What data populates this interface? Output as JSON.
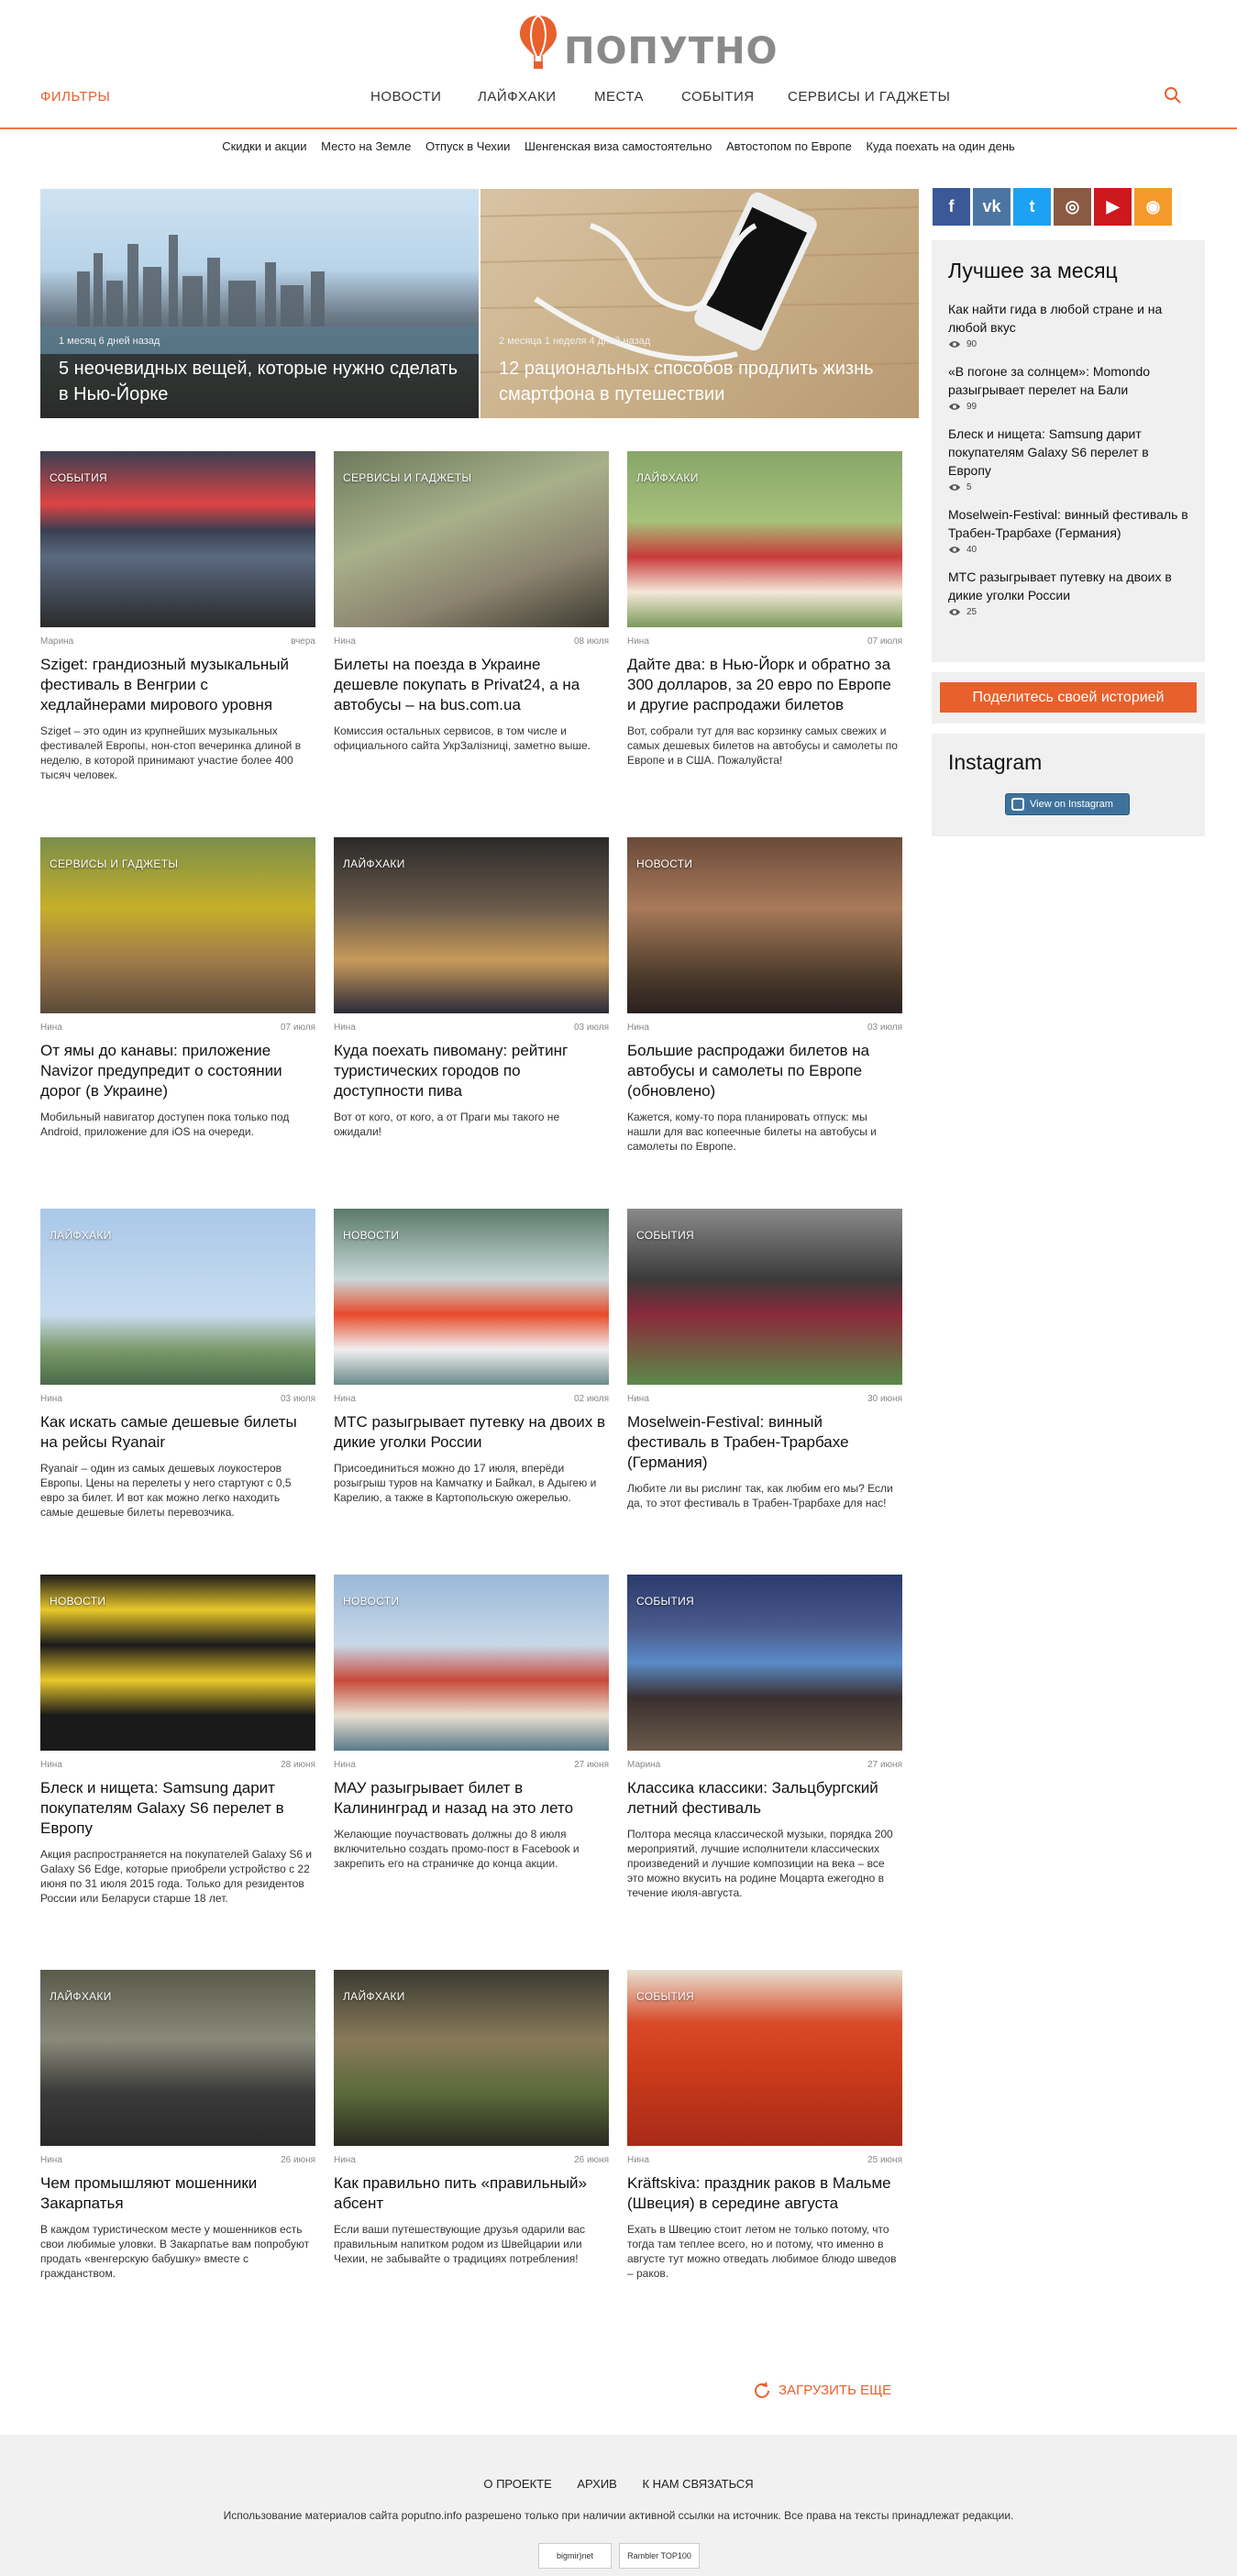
{
  "header": {
    "logo_text": "ПОПУТНО",
    "filters": "ФИЛЬТРЫ",
    "nav": [
      "НОВОСТИ",
      "ЛАЙФХАКИ",
      "МЕСТА",
      "СОБЫТИЯ",
      "СЕРВИСЫ И ГАДЖЕТЫ"
    ]
  },
  "tags": [
    "Скидки и акции",
    "Место на Земле",
    "Отпуск в Чехии",
    "Шенгенская виза самостоятельно",
    "Автостопом по Европе",
    "Куда поехать на один день"
  ],
  "hero": [
    {
      "meta": "1 месяц 6 дней назад",
      "title": "5 неочевидных вещей, которые нужно сделать в Нью-Йорке"
    },
    {
      "meta": "2 месяца 1 неделя 4 дней назад",
      "title": "12 рациональных способов продлить жизнь смартфона в путешествии"
    }
  ],
  "cards": [
    {
      "cat": "СОБЫТИЯ",
      "author": "Марина",
      "date": "вчера",
      "title": "Sziget: грандиозный музыкальный фестиваль в Венгрии с хедлайнерами мирового уровня",
      "text": "Sziget – это один из крупнейших музыкальных фестивалей Европы, нон-стоп вечеринка длиной в неделю, в которой принимают участие более 400 тысяч человек."
    },
    {
      "cat": "СЕРВИСЫ И ГАДЖЕТЫ",
      "author": "Нина",
      "date": "08 июля",
      "title": "Билеты на поезда в Украине дешевле покупать в Privat24, а на автобусы – на bus.com.ua",
      "text": "Комиссия остальных сервисов, в том числе и официального сайта УкрЗалізниці, заметно выше."
    },
    {
      "cat": "ЛАЙФХАКИ",
      "author": "Нина",
      "date": "07 июля",
      "title": "Дайте два: в Нью-Йорк и обратно за 300 долларов, за 20 евро по Европе и другие распродажи билетов",
      "text": "Вот, собрали тут для вас корзинку самых свежих и самых дешевых билетов на автобусы и самолеты по Европе и в США. Пожалуйста!"
    },
    {
      "cat": "СЕРВИСЫ И ГАДЖЕТЫ",
      "author": "Нина",
      "date": "07 июля",
      "title": "От ямы до канавы: приложение Navizor предупредит о состоянии дорог (в Украине)",
      "text": "Мобильный навигатор доступен пока только под Android, приложение для iOS на очереди."
    },
    {
      "cat": "ЛАЙФХАКИ",
      "author": "Нина",
      "date": "03 июля",
      "title": "Куда поехать пивоману: рейтинг туристических городов по доступности пива",
      "text": "Вот от кого, от кого, а от Праги мы такого не ожидали!"
    },
    {
      "cat": "НОВОСТИ",
      "author": "Нина",
      "date": "03 июля",
      "title": "Большие распродажи билетов на автобусы и самолеты по Европе (обновлено)",
      "text": "Кажется, кому-то пора планировать отпуск: мы нашли для вас копеечные билеты на автобусы и самолеты по Европе."
    },
    {
      "cat": "ЛАЙФХАКИ",
      "author": "Нина",
      "date": "03 июля",
      "title": "Как искать самые дешевые билеты на рейсы Ryanair",
      "text": "Ryanair – один из самых дешевых лоукостеров Европы. Цены на перелеты у него стартуют с 0,5 евро за билет. И вот как можно легко находить самые дешевые билеты перевозчика."
    },
    {
      "cat": "НОВОСТИ",
      "author": "Нина",
      "date": "02 июля",
      "title": "МТС разыгрывает путевку на двоих в дикие уголки России",
      "text": "Присоединиться можно до 17 июля, вперёди розыгрыш туров на Камчатку и Байкал, в Адыгею и Карелию, а также в Картопольскую ожерелью."
    },
    {
      "cat": "СОБЫТИЯ",
      "author": "Нина",
      "date": "30 июня",
      "title": "Moselwein-Festival: винный фестиваль в Трабен-Трарбахе (Германия)",
      "text": "Любите ли вы рислинг так, как любим его мы? Если да, то этот фестиваль в Трабен-Трарбахе для нас!"
    },
    {
      "cat": "НОВОСТИ",
      "author": "Нина",
      "date": "28 июня",
      "title": "Блеск и нищета: Samsung дарит покупателям Galaxy S6 перелет в Европу",
      "text": "Акция распространяется на покупателей Galaxy S6 и Galaxy S6 Edge, которые приобрели устройство с 22 июня по 31 июля 2015 года. Только для резидентов России или Беларуси старше 18 лет."
    },
    {
      "cat": "НОВОСТИ",
      "author": "Нина",
      "date": "27 июня",
      "title": "МАУ разыгрывает билет в Калининград и назад на это лето",
      "text": "Желающие поучаствовать должны до 8 июля включительно создать промо-пост в Facebook и закрепить его на страничке до конца акции."
    },
    {
      "cat": "СОБЫТИЯ",
      "author": "Марина",
      "date": "27 июня",
      "title": "Классика классики: Зальцбургский летний фестиваль",
      "text": "Полтора месяца классической музыки, порядка 200 мероприятий, лучшие исполнители классических произведений и лучшие композиции на века – все это можно вкусить на родине Моцарта ежегодно в течение июля-августа."
    },
    {
      "cat": "ЛАЙФХАКИ",
      "author": "Нина",
      "date": "26 июня",
      "title": "Чем промышляют мошенники Закарпатья",
      "text": "В каждом туристическом месте у мошенников есть свои любимые уловки. В Закарпатье вам попробуют продать «венгерскую бабушку» вместе с гражданством."
    },
    {
      "cat": "ЛАЙФХАКИ",
      "author": "Нина",
      "date": "26 июня",
      "title": "Как правильно пить «правильный» абсент",
      "text": "Если ваши путешествующие друзья одарили вас правильным напитком родом из Швейцарии или Чехии, не забывайте о традициях потребления!"
    },
    {
      "cat": "СОБЫТИЯ",
      "author": "Нина",
      "date": "25 июня",
      "title": "Kräftskiva: праздник раков в Мальме (Швеция) в середине августа",
      "text": "Ехать в Швецию стоит летом не только потому, что тогда там теплее всего, но и потому, что именно в августе тут можно отведать любимое блюдо шведов – раков."
    }
  ],
  "social": [
    {
      "icon": "facebook-icon",
      "glyph": "f",
      "color": "#3b5998"
    },
    {
      "icon": "vk-icon",
      "glyph": "vk",
      "color": "#4c75a3"
    },
    {
      "icon": "twitter-icon",
      "glyph": "t",
      "color": "#1da1f2"
    },
    {
      "icon": "instagram-icon",
      "glyph": "◎",
      "color": "#8a5a44"
    },
    {
      "icon": "youtube-icon",
      "glyph": "▶",
      "color": "#cc181e"
    },
    {
      "icon": "rss-icon",
      "glyph": "◉",
      "color": "#f59a2a"
    }
  ],
  "best": {
    "title": "Лучшее за месяц",
    "items": [
      {
        "title": "Как найти гида в любой стране и на любой вкус",
        "views": "90"
      },
      {
        "title": "«В погоне за солнцем»: Momondo разыгрывает перелет на Бали",
        "views": "99"
      },
      {
        "title": "Блеск и нищета: Samsung дарит покупателям Galaxy S6 перелет в Европу",
        "views": "5"
      },
      {
        "title": "Moselwein-Festival: винный фестиваль в Трабен-Трарбахе (Германия)",
        "views": "40"
      },
      {
        "title": "МТС разыгрывает путевку на двоих в дикие уголки России",
        "views": "25"
      }
    ]
  },
  "share": "Поделитесь своей историей",
  "instagram": {
    "title": "Instagram",
    "button": "View on Instagram"
  },
  "load_more": "ЗАГРУЗИТЬ ЕЩЕ",
  "footer": {
    "links": [
      "О ПРОЕКТЕ",
      "АРХИВ",
      "К НАМ СВЯЗАТЬСЯ"
    ],
    "copyright": "Использование материалов сайта poputno.info разрешено только при наличии активной ссылки на источник. Все права на тексты принадлежат редакции.",
    "badge_left": "bigmir)net",
    "badge_right": "Rambler TOP100"
  },
  "colors": {
    "accent": "#e8602c"
  }
}
